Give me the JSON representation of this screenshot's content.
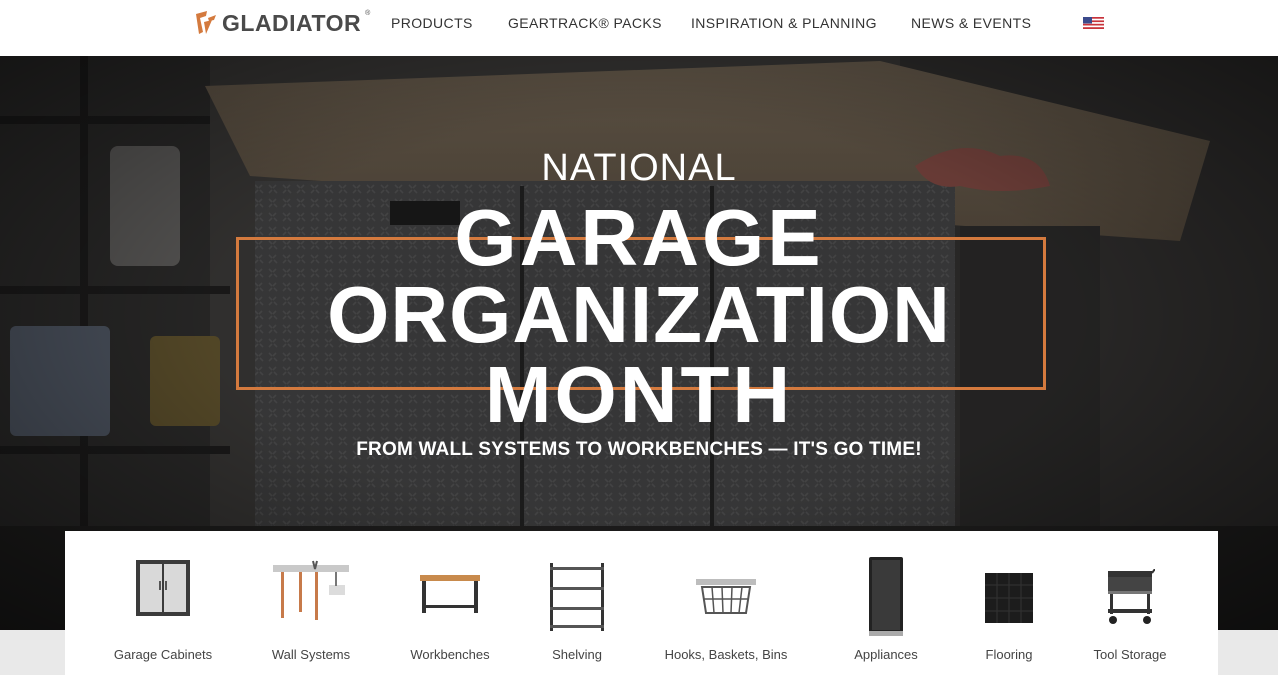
{
  "brand": {
    "logo_text": "GLADIATOR",
    "trademark": "®",
    "accent": "#d47a3e",
    "logo_color": "#4a4a4a"
  },
  "nav": {
    "items": [
      {
        "label": "PRODUCTS"
      },
      {
        "label": "GEARTRACK® PACKS"
      },
      {
        "label": "INSPIRATION & PLANNING"
      },
      {
        "label": "NEWS & EVENTS"
      }
    ],
    "flag_icon": "us-flag-icon"
  },
  "hero": {
    "line1": "NATIONAL",
    "line2": "GARAGE",
    "line3": "ORGANIZATION",
    "line4": "MONTH",
    "subtitle": "FROM WALL SYSTEMS TO WORKBENCHES — IT'S GO TIME!",
    "frame_color": "#d47a3e",
    "background": "garage workbench with diamond-plate cabinets"
  },
  "categories": [
    {
      "label": "Garage Cabinets",
      "icon": "cabinet-icon"
    },
    {
      "label": "Wall Systems",
      "icon": "wall-system-icon"
    },
    {
      "label": "Workbenches",
      "icon": "workbench-icon"
    },
    {
      "label": "Shelving",
      "icon": "shelving-icon"
    },
    {
      "label": "Hooks, Baskets, Bins",
      "icon": "basket-icon"
    },
    {
      "label": "Appliances",
      "icon": "refrigerator-icon"
    },
    {
      "label": "Flooring",
      "icon": "floor-tile-icon"
    },
    {
      "label": "Tool Storage",
      "icon": "tool-cart-icon"
    }
  ]
}
